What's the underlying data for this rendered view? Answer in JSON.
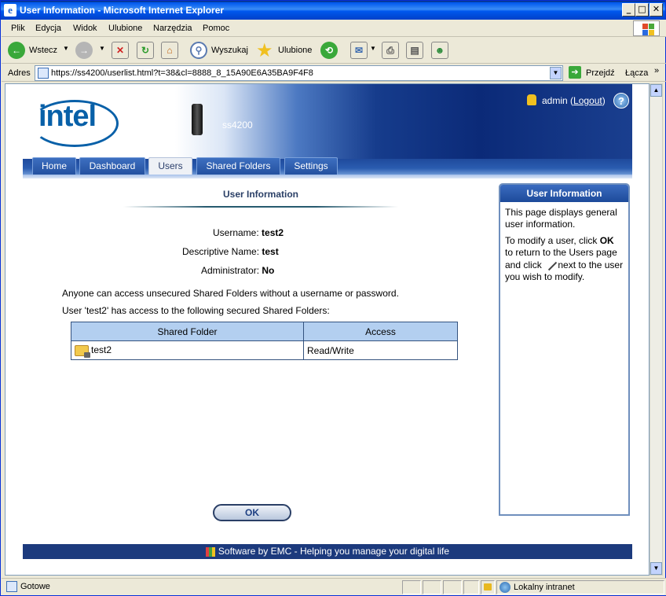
{
  "window": {
    "title": "User Information - Microsoft Internet Explorer",
    "minimize": "_",
    "maximize": "□",
    "close": "✕"
  },
  "menu": [
    "Plik",
    "Edycja",
    "Widok",
    "Ulubione",
    "Narzędzia",
    "Pomoc"
  ],
  "toolbar": {
    "back_label": "Wstecz",
    "search_label": "Wyszukaj",
    "favorites_label": "Ulubione"
  },
  "address": {
    "label": "Adres",
    "url": "https://ss4200/userlist.html?t=38&cl=8888_8_15A90E6A35BA9F4F8",
    "go_label": "Przejdź",
    "links_label": "Łącza"
  },
  "header": {
    "logo_text": "intel",
    "device_label": "ss4200",
    "user": "admin",
    "logout": "Logout",
    "help": "?"
  },
  "nav": {
    "tabs": [
      "Home",
      "Dashboard",
      "Users",
      "Shared Folders",
      "Settings"
    ],
    "active": "Users"
  },
  "main": {
    "title": "User Information",
    "username_label": "Username:",
    "username_value": "test2",
    "descname_label": "Descriptive Name:",
    "descname_value": "test",
    "admin_label": "Administrator:",
    "admin_value": "No",
    "unsecured_note": "Anyone can access unsecured Shared Folders without a username or password.",
    "access_note": "User 'test2' has access to the following secured Shared Folders:",
    "table": {
      "headers": [
        "Shared Folder",
        "Access"
      ],
      "rows": [
        [
          "test2",
          "Read/Write"
        ]
      ]
    },
    "ok_button": "OK"
  },
  "right_panel": {
    "title": "User Information",
    "para1": "This page displays general user information.",
    "para2_a": "To modify a user, click ",
    "para2_ok": "OK",
    "para2_b": " to return to the Users page and click ",
    "para2_c": " next to the user you wish to modify."
  },
  "footer": {
    "text": "Software by EMC - Helping you manage your digital life"
  },
  "status": {
    "left": "Gotowe",
    "zone": "Lokalny intranet"
  }
}
